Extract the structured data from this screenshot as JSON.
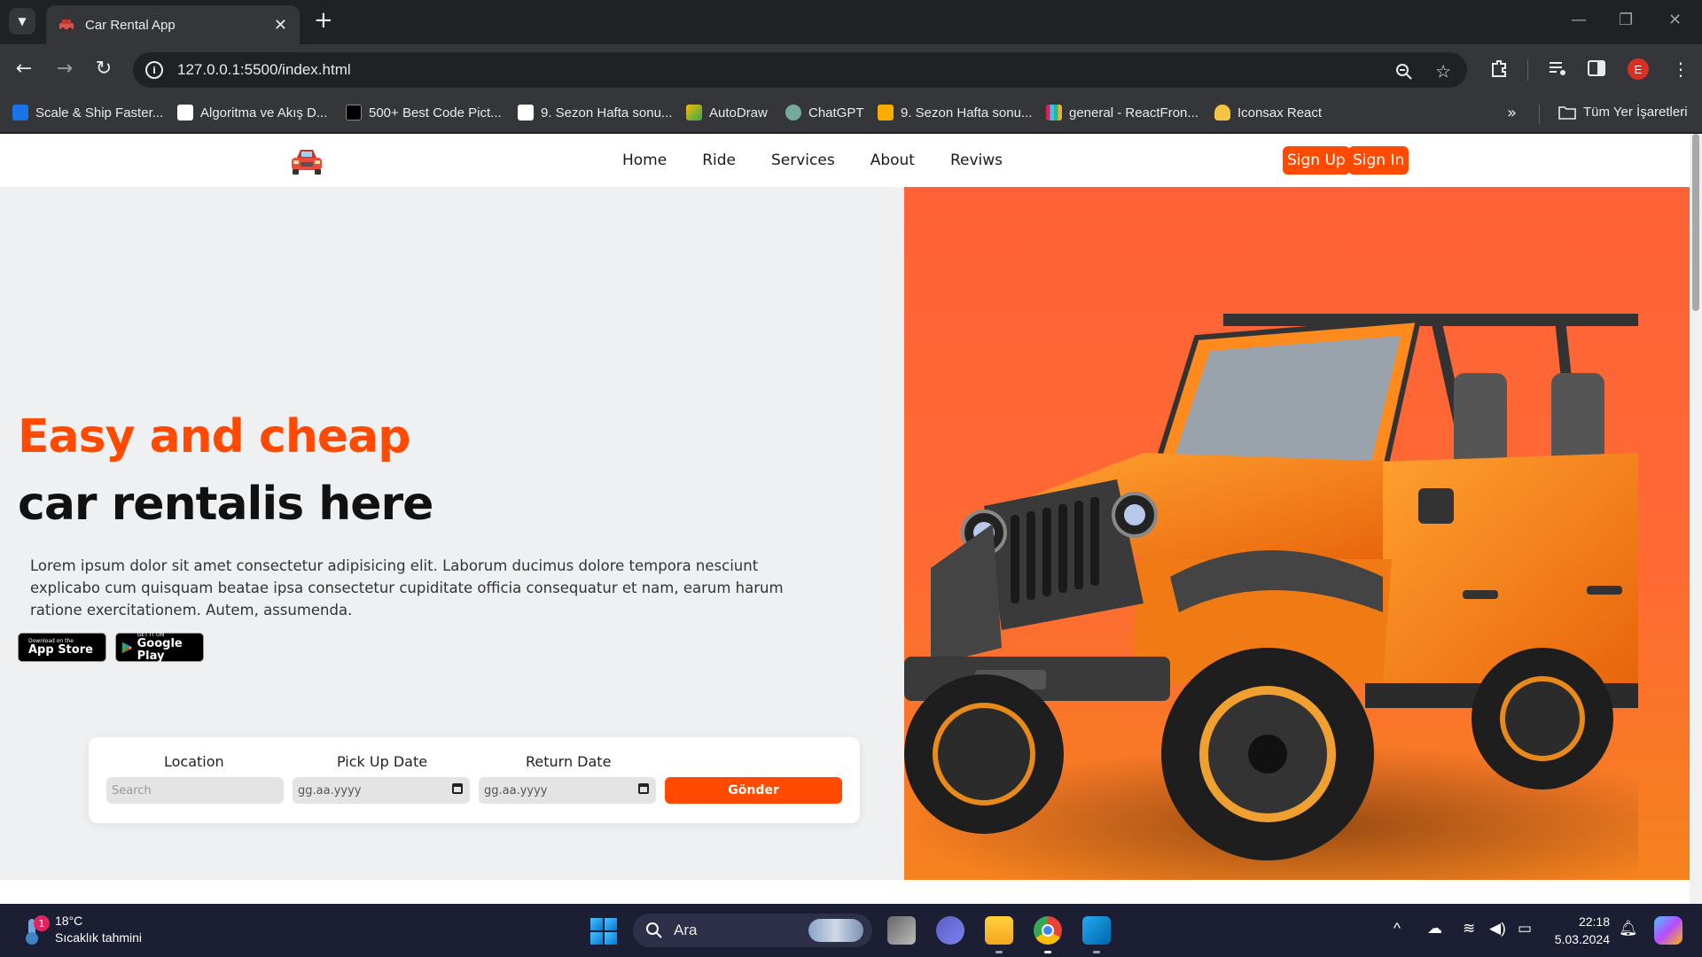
{
  "browser": {
    "tab_title": "Car Rental App",
    "url": "127.0.0.1:5500/index.html",
    "profile_initial": "E",
    "bookmarks": [
      {
        "label": "Scale & Ship Faster..."
      },
      {
        "label": "Algoritma ve Akış D..."
      },
      {
        "label": "500+ Best Code Pict..."
      },
      {
        "label": "9. Sezon Hafta sonu..."
      },
      {
        "label": "AutoDraw"
      },
      {
        "label": "ChatGPT"
      },
      {
        "label": "9. Sezon Hafta sonu..."
      },
      {
        "label": "general - ReactFron..."
      },
      {
        "label": "Iconsax React"
      }
    ],
    "all_bookmarks_label": "Tüm Yer İşaretleri"
  },
  "site": {
    "nav": [
      "Home",
      "Ride",
      "Services",
      "About",
      "Reviws"
    ],
    "sign_up": "Sign Up",
    "sign_in": "Sign In",
    "headline_accent": "Easy and cheap",
    "headline_main": "car rentalis here",
    "description": "Lorem ipsum dolor sit amet consectetur adipisicing elit. Laborum ducimus dolore tempora nesciunt explicabo cum quisquam beatae ipsa consectetur cupiditate officia consequatur et nam, earum harum ratione exercitationem. Autem, assumenda.",
    "app_store": {
      "small": "Download on the",
      "big": "App Store"
    },
    "google_play": {
      "small": "GET IT ON",
      "big": "Google Play"
    },
    "booking": {
      "location_label": "Location",
      "location_placeholder": "Search",
      "pickup_label": "Pick Up Date",
      "pickup_value": "gg.aa.yyyy",
      "return_label": "Return Date",
      "return_value": "gg.aa.yyyy",
      "submit_label": "Gönder"
    },
    "accent_color": "#ff4a00"
  },
  "taskbar": {
    "weather_temp": "18°C",
    "weather_desc": "Sıcaklık tahmini",
    "weather_badge": "1",
    "search_label": "Ara",
    "time": "22:18",
    "date": "5.03.2024"
  }
}
